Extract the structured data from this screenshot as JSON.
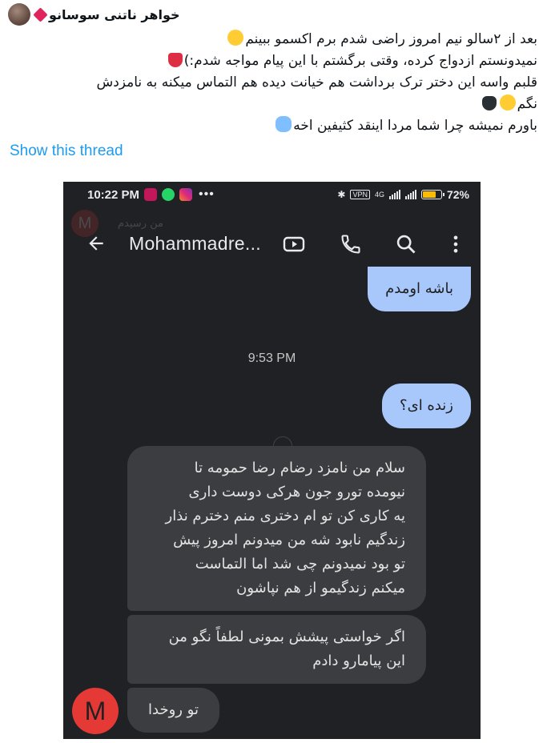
{
  "tweet": {
    "author_name": "خواهر ناتنی سوسانو",
    "lines": [
      "بعد از ۲سالو نیم امروز راضی شدم برم اکسمو ببینم",
      "نمیدونستم ازدواج کرده، وقتی برگشتم با این پیام مواجه شدم:)",
      "قلبم واسه این دختر ترک برداشت هم خیانت دیده هم التماس میکنه به نامزدش",
      "نگم",
      "باورم نمیشه چرا شما مردا اینقد کثیفین اخه"
    ],
    "emojis": [
      "slightly-smiling-face",
      "broken-heart",
      "pensive-face",
      "black-heart",
      "loudly-crying-face"
    ],
    "show_thread_label": "Show this thread"
  },
  "phone": {
    "status_bar": {
      "time": "10:22 PM",
      "vpn_label": "VPN",
      "network_label": "4G",
      "battery_percent": "72%",
      "battery_level": 0.72,
      "app_icons": [
        "play-icon",
        "whatsapp-icon",
        "instagram-icon"
      ]
    },
    "ghost_overlay": {
      "avatar_letter": "M",
      "text": "من رسیدم"
    },
    "app_bar": {
      "contact_name": "Mohammadre...",
      "icons": [
        "back-arrow-icon",
        "video-call-icon",
        "phone-icon",
        "search-icon",
        "more-vert-icon"
      ]
    },
    "messages": {
      "out_1": "باشه اومدم",
      "timestamp": "9:53 PM",
      "out_2": "زنده ای؟",
      "in_1_lines": [
        "سلام من نامزد رضام رضا حمومه تا",
        "نیومده تورو جون هرکی دوست داری",
        "یه کاری کن تو ام دختری منم دخترم نذار",
        "زندگیم نابود شه من میدونم امروز پیش",
        "تو بود نمیدونم چی شد اما التماست",
        "میکنم زندگیمو از هم نپاشون"
      ],
      "in_2_lines": [
        "اگر خواستی پیشش بمونی لطفاً نگو من",
        "این پیامارو دادم"
      ],
      "in_3": "تو روخدا",
      "sender_avatar_letter": "M"
    },
    "colors": {
      "background": "#202124",
      "outgoing_bubble": "#a8c7fa",
      "incoming_bubble": "#3c3d40",
      "avatar": "#e53935"
    }
  }
}
